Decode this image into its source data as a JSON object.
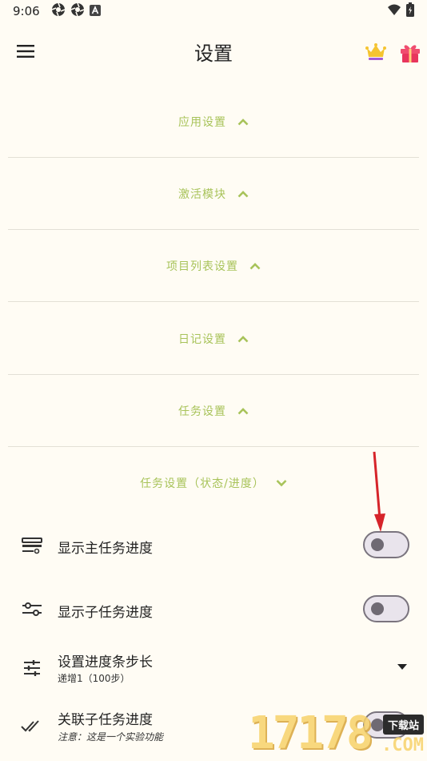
{
  "status_bar": {
    "time": "9:06",
    "icons_left": [
      "aperture-icon",
      "aperture-icon",
      "a-letter-icon"
    ],
    "icons_right": [
      "wifi-icon",
      "battery-charging-icon"
    ]
  },
  "app_bar": {
    "title": "设置",
    "menu_icon": "hamburger-menu-icon",
    "crown_icon": "crown-icon",
    "gift_icon": "gift-icon"
  },
  "sections": [
    {
      "label": "应用设置",
      "expanded": false
    },
    {
      "label": "激活模块",
      "expanded": false
    },
    {
      "label": "项目列表设置",
      "expanded": false
    },
    {
      "label": "日记设置",
      "expanded": false
    },
    {
      "label": "任务设置",
      "expanded": false
    },
    {
      "label": "任务设置（状态/进度）",
      "expanded": true
    }
  ],
  "settings": {
    "show_main_progress": {
      "title": "显示主任务进度",
      "enabled": false
    },
    "show_sub_progress": {
      "title": "显示子任务进度",
      "enabled": false
    },
    "progress_step": {
      "title": "设置进度条步长",
      "value": "递增1（100步）"
    },
    "link_sub_progress": {
      "title": "关联子任务进度",
      "note": "注意：这是一个实验功能",
      "enabled": false
    }
  },
  "watermark": {
    "digits": "17178",
    "badge": "下载站",
    "suffix": ".COM"
  },
  "colors": {
    "background": "#fffcf4",
    "accent": "#a8c35a",
    "annotation": "#d6242a",
    "toggle_track": "#e9e4ec",
    "toggle_border": "#7a747e"
  }
}
